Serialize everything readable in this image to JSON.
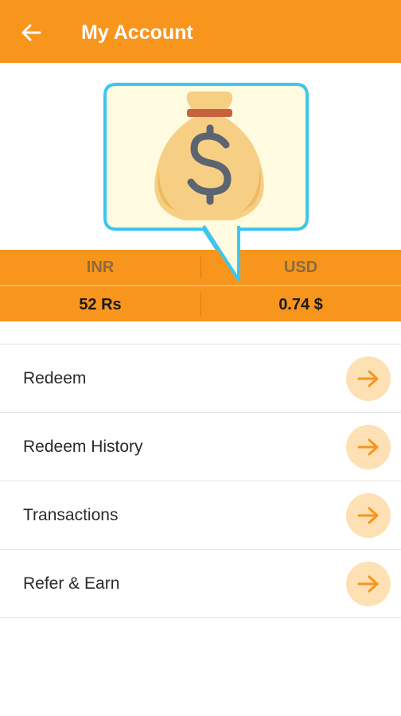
{
  "appbar": {
    "title": "My Account",
    "background": "#f7951d",
    "back_icon": "arrow-left-icon"
  },
  "hero": {
    "illustration": "money-bag-icon",
    "bubble_border": "#3ec6ee"
  },
  "rates": {
    "headers": [
      "INR",
      "USD"
    ],
    "values": [
      "52 Rs",
      "0.74 $"
    ]
  },
  "menu": {
    "items": [
      {
        "label": "Redeem",
        "icon": "arrow-right-icon"
      },
      {
        "label": "Redeem History",
        "icon": "arrow-right-icon"
      },
      {
        "label": "Transactions",
        "icon": "arrow-right-icon"
      },
      {
        "label": "Refer & Earn",
        "icon": "arrow-right-icon"
      }
    ],
    "arrow_bg": "#fde0b3",
    "arrow_color": "#f7951d"
  }
}
